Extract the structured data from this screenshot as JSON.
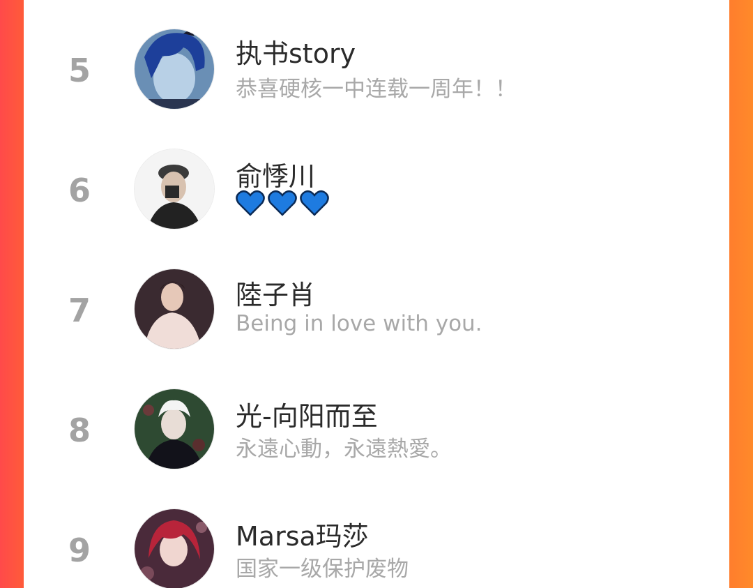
{
  "ranking": {
    "rows": [
      {
        "rank": "5",
        "name": "执书story",
        "signature": "恭喜硬核一中连载一周年！！"
      },
      {
        "rank": "6",
        "name": "俞悸川",
        "signature": "💙💙💙",
        "signature_icons": [
          "blue-heart-icon",
          "blue-heart-icon",
          "blue-heart-icon"
        ]
      },
      {
        "rank": "7",
        "name": "陸子肖",
        "signature": "Being in love with you."
      },
      {
        "rank": "8",
        "name": "光-向阳而至",
        "signature": "永遠心動，永遠熱愛。"
      },
      {
        "rank": "9",
        "name": "Marsa玛莎",
        "signature": "国家一级保护废物"
      }
    ]
  },
  "colors": {
    "background_left": "#ff4a4a",
    "background_right": "#ff8a2a",
    "rank_text": "#a3a3a3",
    "name_text": "#2a2a2a",
    "signature_text": "#a8a8a8",
    "heart_blue": "#1e7be0"
  }
}
